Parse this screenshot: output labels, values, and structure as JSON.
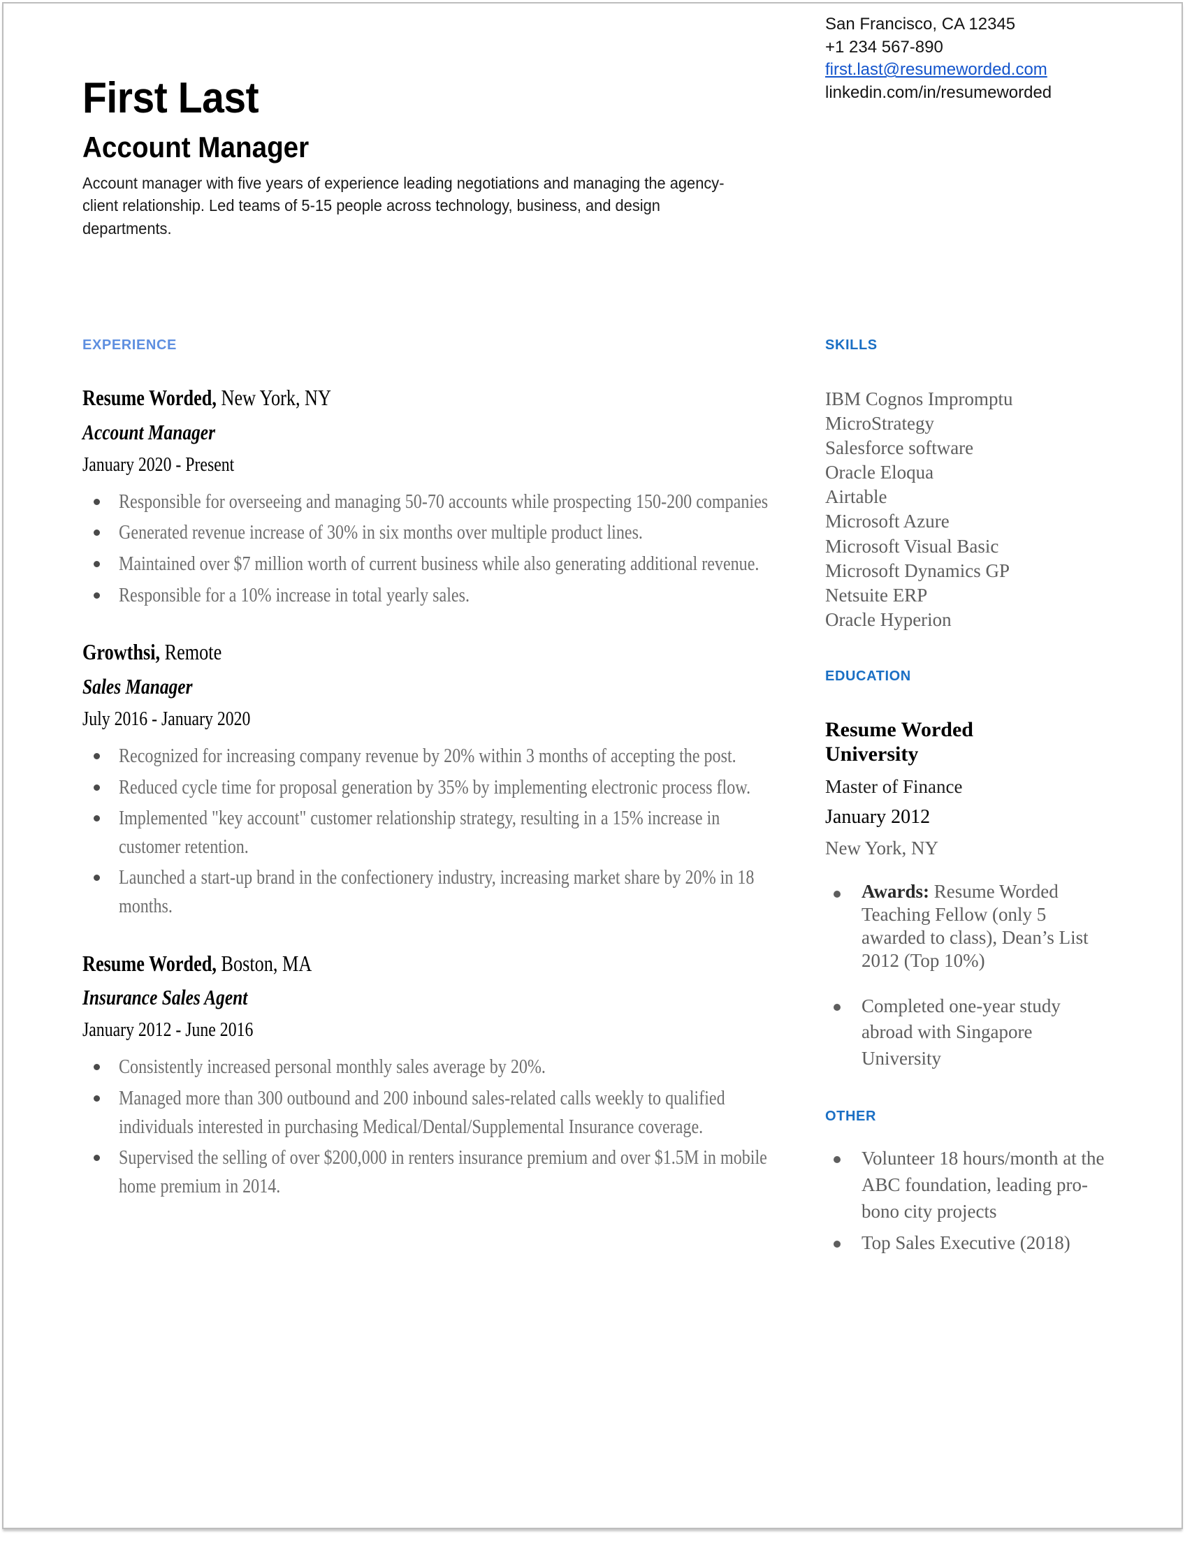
{
  "colors": {
    "accent_blue_light": "#5e8fe0",
    "accent_blue": "#1a6fc4",
    "link_blue": "#1455cc",
    "body_gray": "#6e6e6e"
  },
  "header": {
    "name": "First Last",
    "headline": "Account Manager",
    "summary": "Account manager with five years of experience leading negotiations and managing the agency-client relationship. Led teams of 5-15 people across technology, business, and design departments."
  },
  "contact": {
    "location": "San Francisco, CA 12345",
    "phone": "+1 234 567-890",
    "email": "first.last@resumeworded.com",
    "linkedin": "linkedin.com/in/resumeworded"
  },
  "experience": {
    "heading": "EXPERIENCE",
    "jobs": [
      {
        "company": "Resume Worded,",
        "location": " New York, NY",
        "role": "Account Manager",
        "dates": "January 2020 - Present",
        "bullets": [
          "Responsible for overseeing and managing 50-70 accounts while prospecting 150-200 companies",
          "Generated revenue increase of 30% in six months over multiple product lines.",
          "Maintained over $7 million worth of current business while also generating additional revenue.",
          "Responsible for a 10% increase in total yearly sales."
        ]
      },
      {
        "company": "Growthsi,",
        "location": " Remote",
        "role": "Sales Manager",
        "dates": "July 2016 - January 2020",
        "bullets": [
          "Recognized for increasing company revenue by 20% within 3 months of accepting the post.",
          "Reduced cycle time for proposal generation by 35% by implementing electronic process flow.",
          "Implemented \"key account\" customer relationship strategy, resulting in a 15% increase in customer retention.",
          "Launched a start-up brand in the confectionery industry, increasing market share by 20% in 18 months."
        ]
      },
      {
        "company": "Resume Worded,",
        "location": " Boston, MA",
        "role": "Insurance Sales Agent",
        "dates": "January 2012 - June 2016",
        "bullets": [
          "Consistently increased personal monthly sales average by 20%.",
          "Managed more than 300 outbound and 200 inbound sales-related calls weekly to qualified individuals interested in purchasing Medical/Dental/Supplemental Insurance coverage.",
          "Supervised the selling of over $200,000 in renters insurance premium and over $1.5M in mobile home premium in 2014."
        ]
      }
    ]
  },
  "skills": {
    "heading": "SKILLS",
    "items": [
      "IBM Cognos Impromptu",
      "MicroStrategy",
      "Salesforce software",
      "Oracle Eloqua",
      "Airtable",
      "Microsoft Azure",
      "Microsoft Visual Basic",
      "Microsoft Dynamics GP",
      "Netsuite ERP",
      "Oracle Hyperion"
    ]
  },
  "education": {
    "heading": "EDUCATION",
    "school": "Resume Worded University",
    "degree": "Master of Finance",
    "date": "January 2012",
    "location": "New York, NY",
    "bullets": [
      {
        "label": "Awards:",
        "text": " Resume Worded Teaching Fellow (only 5 awarded to class), Dean’s List 2012 (Top 10%)"
      },
      {
        "label": "",
        "text": "Completed one-year study abroad with Singapore University"
      }
    ]
  },
  "other": {
    "heading": "OTHER",
    "bullets": [
      "Volunteer 18 hours/month at the ABC foundation, leading pro-bono city projects",
      "Top Sales Executive (2018)"
    ]
  }
}
